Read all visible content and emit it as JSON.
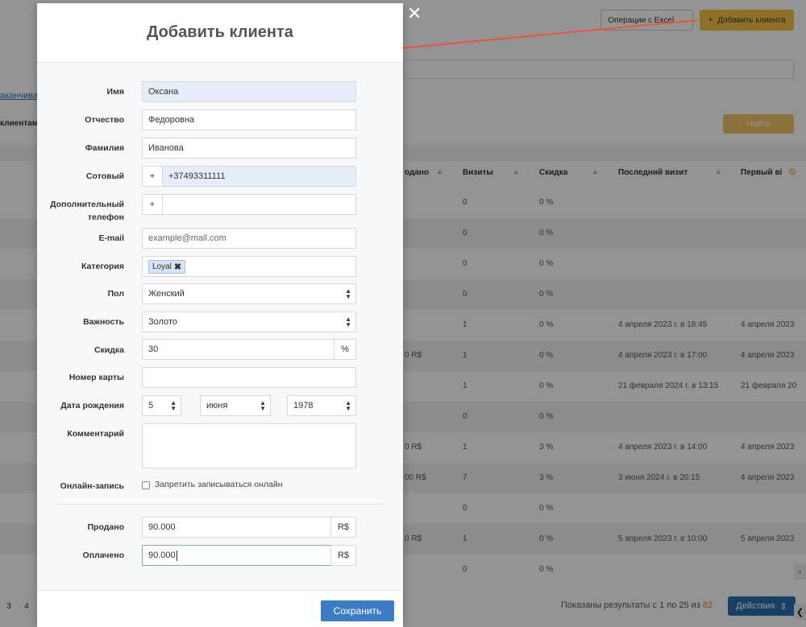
{
  "background": {
    "excel_button": "Операции с Excel",
    "add_client_button": "Добавить клиента",
    "link_text": "аканчива",
    "clients_label": "клиентам",
    "find_button": "Найти",
    "columns": [
      "одано",
      "Визиты",
      "Скидка",
      "Последний визит",
      "Первый ві"
    ],
    "rows": [
      {
        "sold": "",
        "visits": "0",
        "discount": "0 %",
        "last": "",
        "first": ""
      },
      {
        "sold": "",
        "visits": "0",
        "discount": "0 %",
        "last": "",
        "first": ""
      },
      {
        "sold": "",
        "visits": "0",
        "discount": "0 %",
        "last": "",
        "first": ""
      },
      {
        "sold": "",
        "visits": "0",
        "discount": "0 %",
        "last": "",
        "first": ""
      },
      {
        "sold": "",
        "visits": "1",
        "discount": "0 %",
        "last": "4 апреля 2023 г. в 18:45",
        "first": "4 апреля 2023"
      },
      {
        "sold": "0 R$",
        "visits": "1",
        "discount": "0 %",
        "last": "4 апреля 2023 г. в 17:00",
        "first": "4 апреля 2023"
      },
      {
        "sold": "",
        "visits": "1",
        "discount": "0 %",
        "last": "21 февраля 2024 г. в 13:15",
        "first": "21 февраля 20"
      },
      {
        "sold": "",
        "visits": "0",
        "discount": "0 %",
        "last": "",
        "first": ""
      },
      {
        "sold": "0 R$",
        "visits": "1",
        "discount": "3 %",
        "last": "4 апреля 2023 г. в 14:00",
        "first": "4 апреля 2023"
      },
      {
        "sold": "00 R$",
        "visits": "7",
        "discount": "3 %",
        "last": "3 июня 2024 г. в 20:15",
        "first": "4 апреля 2023"
      },
      {
        "sold": "",
        "visits": "0",
        "discount": "0 %",
        "last": "",
        "first": ""
      },
      {
        "sold": "0 R$",
        "visits": "1",
        "discount": "0 %",
        "last": "5 апреля 2023 г. в 10:00",
        "first": "5 апреля 2023"
      },
      {
        "sold": "",
        "visits": "0",
        "discount": "0 %",
        "last": "",
        "first": ""
      }
    ],
    "pager": [
      "3",
      "4"
    ],
    "results_text": "Показаны результаты с 1 по 25 из ",
    "results_total": "82",
    "actions_button": "Действия"
  },
  "modal": {
    "title": "Добавить клиента",
    "fields": {
      "first_name": {
        "label": "Имя",
        "value": "Оксана"
      },
      "patronymic": {
        "label": "Отчество",
        "value": "Федоровна"
      },
      "last_name": {
        "label": "Фамилия",
        "value": "Иванова"
      },
      "mobile": {
        "label": "Сотовый",
        "prefix": "+",
        "value": "+37493311111"
      },
      "extra_phone": {
        "label_line1": "Дополнительный",
        "label_line2": "телефон",
        "prefix": "+",
        "value": ""
      },
      "email": {
        "label": "E-mail",
        "placeholder": "example@mail.com"
      },
      "category": {
        "label": "Категория",
        "tag": "Loyal"
      },
      "gender": {
        "label": "Пол",
        "value": "Женский"
      },
      "importance": {
        "label": "Важность",
        "value": "Золото"
      },
      "discount": {
        "label": "Скидка",
        "value": "30",
        "suffix": "%"
      },
      "card_number": {
        "label": "Номер карты",
        "value": ""
      },
      "birth_date": {
        "label": "Дата рождения",
        "day": "5",
        "month": "июня",
        "year": "1978"
      },
      "comment": {
        "label": "Комментарий",
        "value": ""
      },
      "online_booking": {
        "label": "Онлайн-запись",
        "checkbox_label": "Запретить записываться онлайн",
        "checked": false
      },
      "sold": {
        "label": "Продано",
        "value": "90.000",
        "suffix": "R$"
      },
      "paid": {
        "label": "Оплачено",
        "value": "90.000",
        "suffix": "R$"
      }
    },
    "save_button": "Сохранить"
  },
  "colors": {
    "accent_yellow": "#f5c242",
    "primary_blue": "#3b7dc4",
    "annotation_arrow": "#e8553a"
  }
}
